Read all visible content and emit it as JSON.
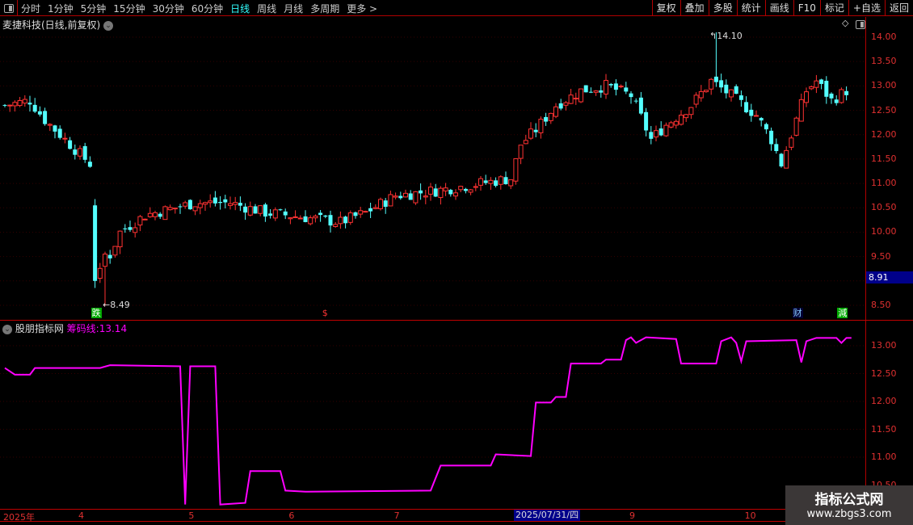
{
  "toolbar": {
    "periods": [
      "分时",
      "1分钟",
      "5分钟",
      "15分钟",
      "30分钟",
      "60分钟",
      "日线",
      "周线",
      "月线",
      "多周期",
      "更多 >"
    ],
    "active_period": "日线",
    "tools": [
      "复权",
      "叠加",
      "多股",
      "统计",
      "画线",
      "F10",
      "标记",
      "+自选",
      "返回"
    ]
  },
  "main": {
    "title": "麦捷科技(日线,前复权)",
    "price_ticks": [
      "14.00",
      "13.50",
      "13.00",
      "12.50",
      "12.00",
      "11.50",
      "11.00",
      "10.50",
      "10.00",
      "9.50",
      "8.50"
    ],
    "current_price": "8.91",
    "high_label": "14.10",
    "low_label": "8.49",
    "signals": [
      {
        "text": "跌",
        "bar": 18,
        "color": "#0a0",
        "fg": "#fff"
      },
      {
        "text": "$",
        "bar": 64,
        "color": "transparent",
        "fg": "#f33"
      },
      {
        "text": "财",
        "bar": 158,
        "color": "#003",
        "fg": "#8cf"
      },
      {
        "text": "減",
        "bar": 167,
        "color": "#0a0",
        "fg": "#fff"
      }
    ]
  },
  "indicator": {
    "name": "股朋指标网",
    "line_label": "筹码线:",
    "line_value": "13.14",
    "ticks": [
      "13.00",
      "12.50",
      "12.00",
      "11.50",
      "11.00",
      "10.50"
    ],
    "line_color": "#ff00ff"
  },
  "xaxis": {
    "labels": [
      {
        "text": "2025年",
        "bar": 0
      },
      {
        "text": "4",
        "bar": 15
      },
      {
        "text": "5",
        "bar": 37
      },
      {
        "text": "6",
        "bar": 57
      },
      {
        "text": "7",
        "bar": 78
      },
      {
        "text": "9",
        "bar": 125
      },
      {
        "text": "10",
        "bar": 148
      }
    ],
    "highlight": "2025/07/31/四"
  },
  "watermark": {
    "line1": "指标公式网",
    "line2": "www.zbgs3.com"
  },
  "chart_data": {
    "type": "candlestick",
    "ylim": [
      8.3,
      14.4
    ],
    "close_path": [
      [
        0,
        12.6
      ],
      [
        5,
        12.7
      ],
      [
        8,
        12.3
      ],
      [
        12,
        11.9
      ],
      [
        17,
        11.4
      ],
      [
        18,
        9.0
      ],
      [
        20,
        9.3
      ],
      [
        23,
        10.0
      ],
      [
        28,
        10.35
      ],
      [
        38,
        10.6
      ],
      [
        45,
        10.6
      ],
      [
        52,
        10.4
      ],
      [
        60,
        10.3
      ],
      [
        67,
        10.2
      ],
      [
        72,
        10.4
      ],
      [
        78,
        10.75
      ],
      [
        86,
        10.85
      ],
      [
        95,
        11.0
      ],
      [
        101,
        11.1
      ],
      [
        103,
        11.8
      ],
      [
        106,
        12.1
      ],
      [
        110,
        12.6
      ],
      [
        115,
        12.9
      ],
      [
        120,
        13.0
      ],
      [
        125,
        12.8
      ],
      [
        129,
        11.9
      ],
      [
        132,
        12.2
      ],
      [
        137,
        12.6
      ],
      [
        141,
        13.1
      ],
      [
        145,
        12.8
      ],
      [
        150,
        12.4
      ],
      [
        153,
        11.9
      ],
      [
        155,
        11.4
      ],
      [
        158,
        12.3
      ],
      [
        160,
        12.9
      ],
      [
        162,
        13.1
      ],
      [
        165,
        12.7
      ],
      [
        168,
        12.9
      ]
    ],
    "line_series": [
      [
        0,
        12.6
      ],
      [
        2,
        12.48
      ],
      [
        5,
        12.48
      ],
      [
        6,
        12.6
      ],
      [
        19,
        12.6
      ],
      [
        21,
        12.65
      ],
      [
        35,
        12.63
      ],
      [
        36,
        10.15
      ],
      [
        37,
        12.63
      ],
      [
        42,
        12.63
      ],
      [
        43,
        10.15
      ],
      [
        48,
        10.18
      ],
      [
        49,
        10.75
      ],
      [
        55,
        10.75
      ],
      [
        56,
        10.4
      ],
      [
        60,
        10.38
      ],
      [
        85,
        10.4
      ],
      [
        87,
        10.85
      ],
      [
        97,
        10.85
      ],
      [
        98,
        11.05
      ],
      [
        105,
        11.02
      ],
      [
        106,
        11.98
      ],
      [
        109,
        11.98
      ],
      [
        110,
        12.08
      ],
      [
        112,
        12.08
      ],
      [
        113,
        12.68
      ],
      [
        119,
        12.68
      ],
      [
        120,
        12.75
      ],
      [
        123,
        12.75
      ],
      [
        124,
        13.1
      ],
      [
        125,
        13.15
      ],
      [
        126,
        13.05
      ],
      [
        128,
        13.15
      ],
      [
        134,
        13.12
      ],
      [
        135,
        12.68
      ],
      [
        142,
        12.68
      ],
      [
        143,
        13.08
      ],
      [
        145,
        13.15
      ],
      [
        146,
        13.05
      ],
      [
        147,
        12.72
      ],
      [
        148,
        13.08
      ],
      [
        158,
        13.1
      ],
      [
        159,
        12.7
      ],
      [
        160,
        13.08
      ],
      [
        162,
        13.14
      ],
      [
        166,
        13.14
      ],
      [
        167,
        13.05
      ],
      [
        168,
        13.14
      ],
      [
        169,
        13.14
      ]
    ]
  }
}
